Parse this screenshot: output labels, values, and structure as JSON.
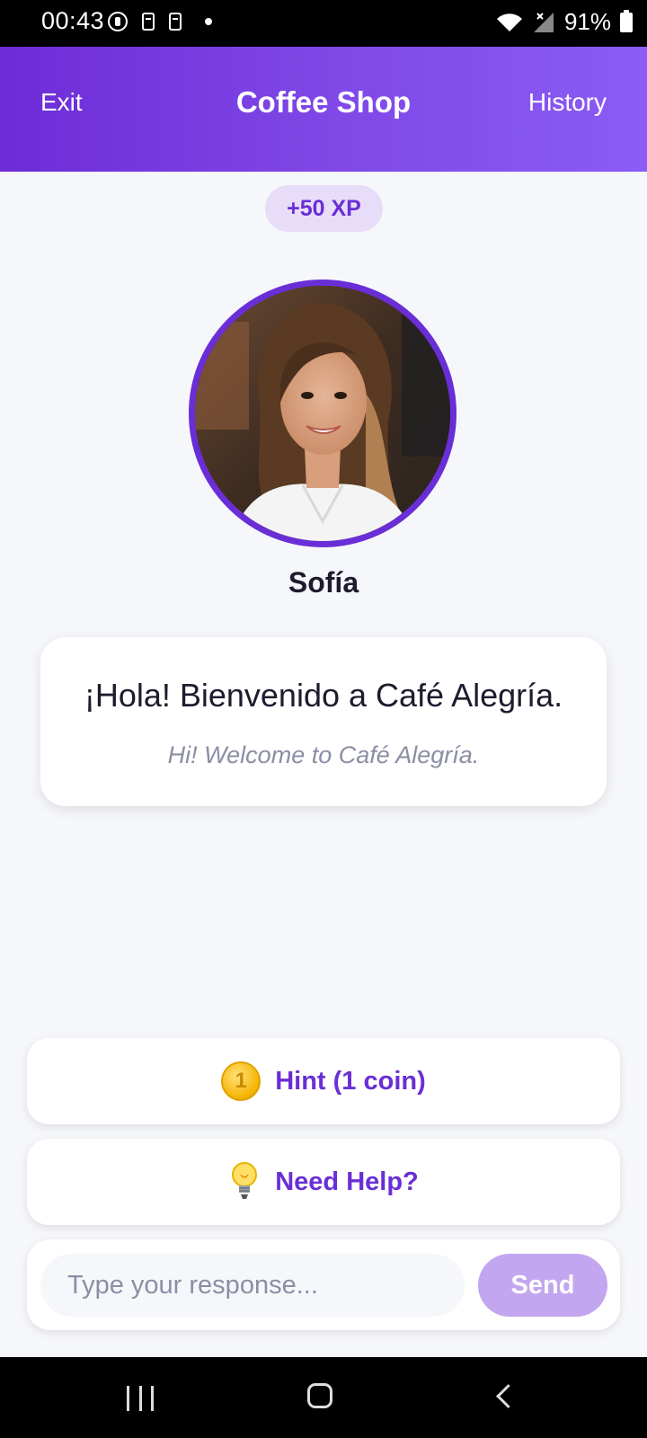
{
  "status_bar": {
    "time": "00:43",
    "battery": "91%"
  },
  "header": {
    "exit_label": "Exit",
    "title": "Coffee Shop",
    "history_label": "History"
  },
  "xp_badge": "+50 XP",
  "character": {
    "name": "Sofía"
  },
  "message": {
    "spanish": "¡Hola! Bienvenido a Café Alegría.",
    "english": "Hi! Welcome to Café Alegría."
  },
  "actions": {
    "hint_label": "Hint (1 coin)",
    "coin_glyph": "1",
    "help_label": "Need Help?"
  },
  "input": {
    "placeholder": "Type your response...",
    "send_label": "Send"
  },
  "colors": {
    "brand_purple": "#6A2ED6",
    "send_disabled": "#C3A6F0"
  }
}
